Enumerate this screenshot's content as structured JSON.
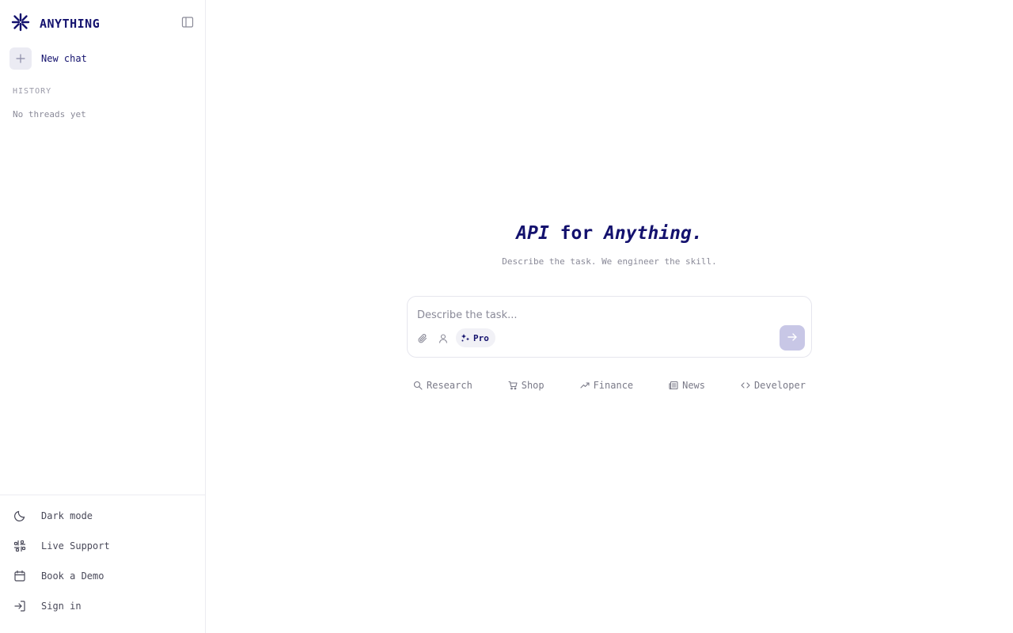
{
  "brand": {
    "name": "ANYTHING",
    "logo_icon": "asterisk-burst-icon",
    "accent": "#14126e"
  },
  "sidebar": {
    "collapse_icon": "sidebar-panel-icon",
    "new_chat_label": "New chat",
    "history_title": "HISTORY",
    "history_empty": "No threads yet",
    "footer": [
      {
        "label": "Dark mode",
        "icon": "moon-icon"
      },
      {
        "label": "Live Support",
        "icon": "slack-icon"
      },
      {
        "label": "Book a Demo",
        "icon": "calendar-icon"
      },
      {
        "label": "Sign in",
        "icon": "sign-in-icon"
      }
    ]
  },
  "hero": {
    "title_part1": "API",
    "title_part2": " for ",
    "title_part3": "Anything.",
    "subtitle": "Describe the task. We engineer the skill."
  },
  "composer": {
    "placeholder": "Describe the task...",
    "mode_label": "Pro",
    "send_color": "#c8c7e6"
  },
  "suggestions": [
    {
      "label": "Research",
      "icon": "search-icon"
    },
    {
      "label": "Shop",
      "icon": "cart-icon"
    },
    {
      "label": "Finance",
      "icon": "trend-up-icon"
    },
    {
      "label": "News",
      "icon": "newspaper-icon"
    },
    {
      "label": "Developer",
      "icon": "code-icon"
    }
  ]
}
